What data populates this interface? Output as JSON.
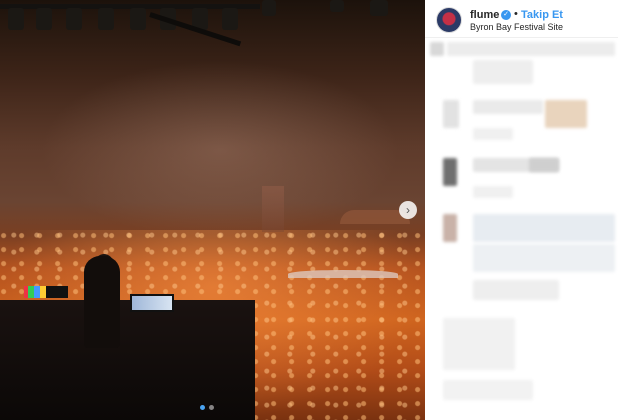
{
  "post": {
    "username": "flume",
    "verified": true,
    "follow_label": "Takip Et",
    "separator": "•",
    "location": "Byron Bay Festival Site",
    "carousel": {
      "total_slides": 2,
      "active_slide": 1
    }
  },
  "colors": {
    "accent": "#3897f0",
    "username": "#262626",
    "divider": "#efefef"
  },
  "icons": {
    "verified": "verified-badge-icon",
    "next": "chevron-right-icon"
  }
}
